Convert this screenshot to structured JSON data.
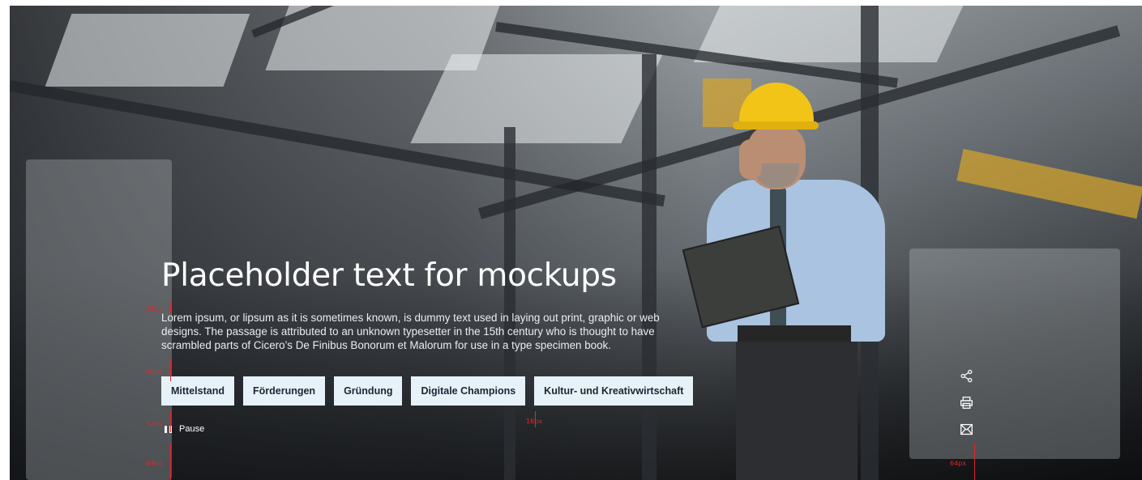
{
  "hero": {
    "title": "Placeholder text for mockups",
    "description": "Lorem ipsum, or lipsum as it is sometimes known, is dummy text used in laying out print, graphic or web designs. The passage is attributed to an unknown typesetter in the 15th century who is thought to have scrambled parts of Cicero’s De Finibus Bonorum et Malorum for use in a type specimen book.",
    "tags": [
      {
        "label": "Mittelstand"
      },
      {
        "label": "Förderungen"
      },
      {
        "label": "Gründung"
      },
      {
        "label": "Digitale Champions"
      },
      {
        "label": "Kultur- und Kreativwirtschaft"
      }
    ],
    "pause_label": "Pause"
  },
  "actions": {
    "icons": [
      "share-icon",
      "print-icon",
      "mail-icon"
    ]
  },
  "spacing_annotations": {
    "title_to_text": "24px",
    "text_to_tags": "40px",
    "tags_to_pause": "32px",
    "tag_gap": "16px",
    "pause_to_bottom": "64px",
    "actions_to_bottom": "64px"
  },
  "colors": {
    "tag_background": "#e6f1f8",
    "tag_text": "#1a2633",
    "annotation": "#e1262e",
    "helmet": "#f2c418"
  }
}
